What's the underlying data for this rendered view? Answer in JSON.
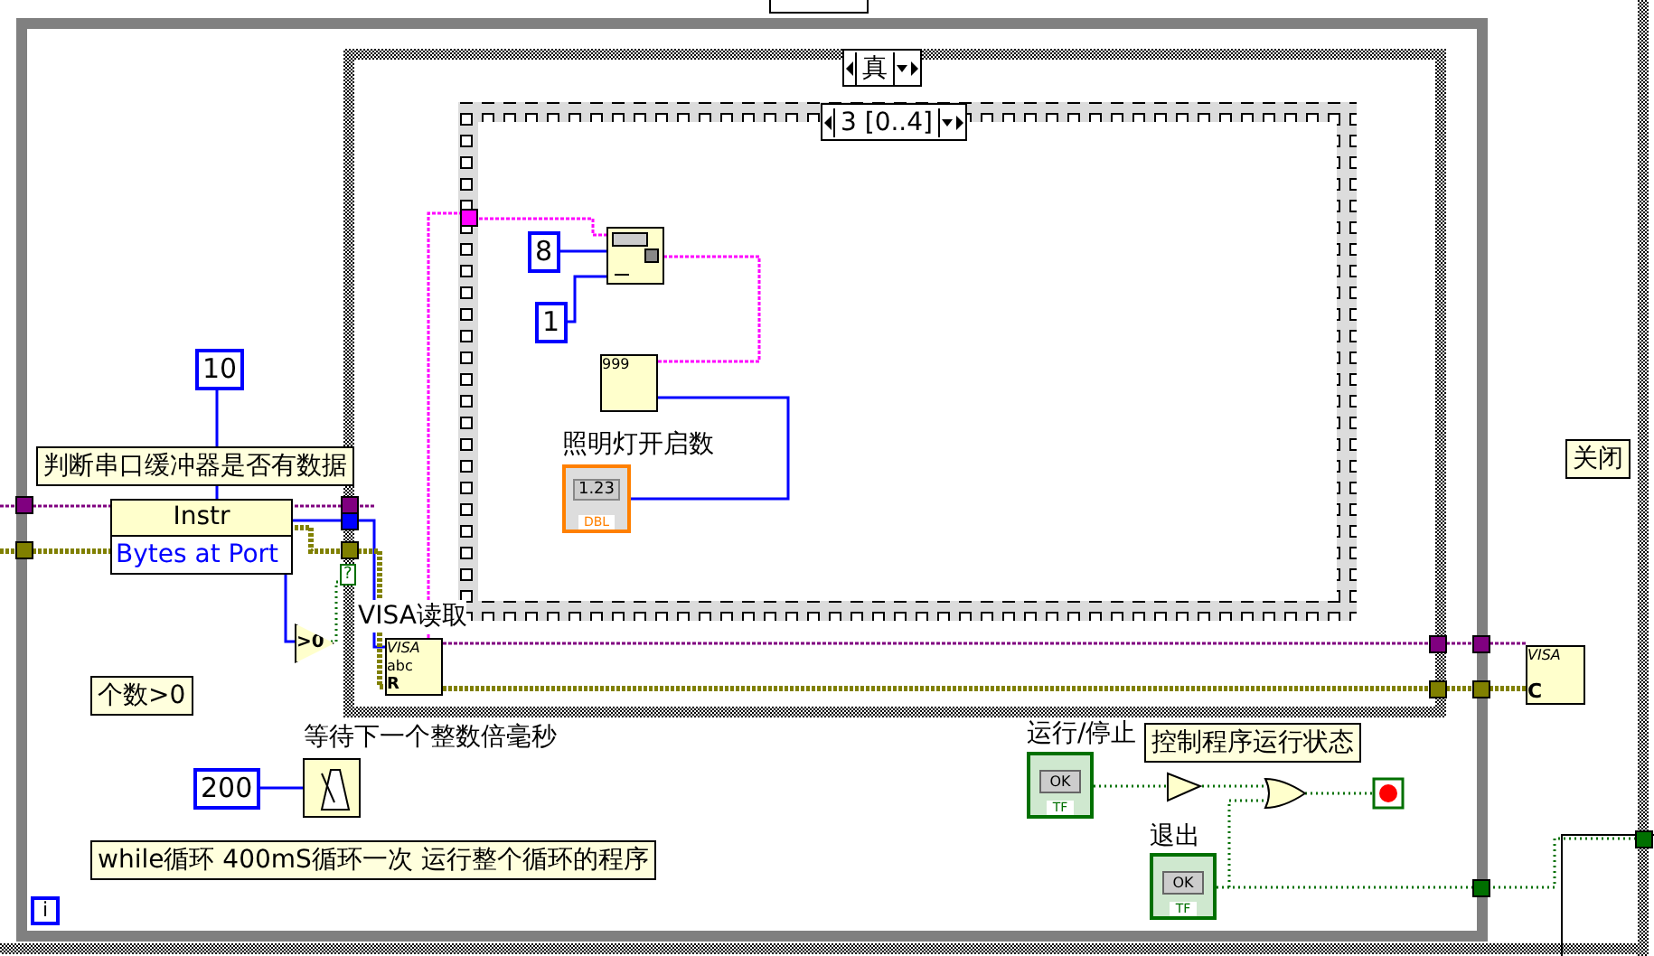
{
  "case_structure": {
    "selector": "真"
  },
  "sequence": {
    "selector": "3 [0..4]"
  },
  "constants": [
    {
      "value": "10"
    },
    {
      "value": "8"
    },
    {
      "value": "1"
    },
    {
      "value": "200"
    }
  ],
  "comments": [
    {
      "text": "判断串口缓冲器是否有数据"
    },
    {
      "text": "个数>0"
    },
    {
      "text": "关闭"
    },
    {
      "text": "控制程序运行状态"
    },
    {
      "text": "while循环  400mS循环一次  运行整个循环的程序"
    }
  ],
  "labels": [
    {
      "text": "VISA读取"
    },
    {
      "text": "照明灯开启数"
    },
    {
      "text": "等待下一个整数倍毫秒"
    },
    {
      "text": "运行/停止"
    },
    {
      "text": "退出"
    }
  ],
  "property_node": {
    "header": "Instr",
    "property": "Bytes at Port"
  },
  "compare_node": {
    "text": ">0"
  },
  "case_tunnel": {
    "text": "?"
  },
  "visa_read": {
    "title": "VISA",
    "port": "abc",
    "mode": "R"
  },
  "visa_close": {
    "title": "VISA",
    "mode": "C"
  },
  "scan_node": {
    "text": "999"
  },
  "indicator": {
    "value": "1.23",
    "type": "DBL"
  },
  "buttons": [
    {
      "label": "OK",
      "type": "TF"
    },
    {
      "label": "OK",
      "type": "TF"
    }
  ],
  "iteration": {
    "text": "i"
  }
}
